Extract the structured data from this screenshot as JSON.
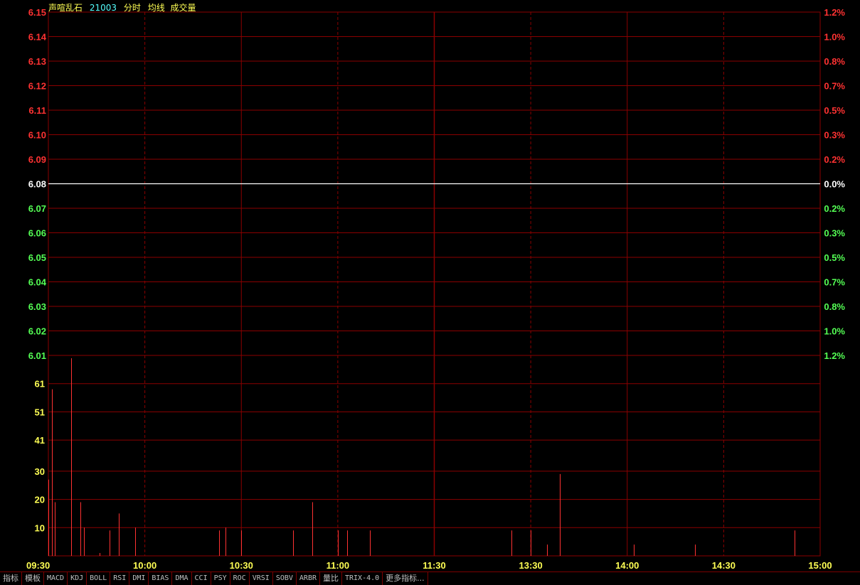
{
  "header": {
    "name": "声喧乱石",
    "code": "21003",
    "ind_time": "分时",
    "ind_avg": "均线",
    "ind_vol": "成交量"
  },
  "colors": {
    "background": "#000000",
    "grid": "#8b0000",
    "up": "#ff3232",
    "down": "#54ff54",
    "neutral": "#ffffff",
    "volume_label": "#ffff54",
    "time_label": "#ffff54",
    "bar": "#ff3232"
  },
  "chart_data": [
    {
      "type": "line",
      "title": "分时",
      "base_price": 6.08,
      "y_ticks": [
        {
          "price": "6.15",
          "pct": "1.2%",
          "dir": "up"
        },
        {
          "price": "6.14",
          "pct": "1.0%",
          "dir": "up"
        },
        {
          "price": "6.13",
          "pct": "0.8%",
          "dir": "up"
        },
        {
          "price": "6.12",
          "pct": "0.7%",
          "dir": "up"
        },
        {
          "price": "6.11",
          "pct": "0.5%",
          "dir": "up"
        },
        {
          "price": "6.10",
          "pct": "0.3%",
          "dir": "up"
        },
        {
          "price": "6.09",
          "pct": "0.2%",
          "dir": "up"
        },
        {
          "price": "6.08",
          "pct": "0.0%",
          "dir": "flat"
        },
        {
          "price": "6.07",
          "pct": "0.2%",
          "dir": "down"
        },
        {
          "price": "6.06",
          "pct": "0.3%",
          "dir": "down"
        },
        {
          "price": "6.05",
          "pct": "0.5%",
          "dir": "down"
        },
        {
          "price": "6.04",
          "pct": "0.7%",
          "dir": "down"
        },
        {
          "price": "6.03",
          "pct": "0.8%",
          "dir": "down"
        },
        {
          "price": "6.02",
          "pct": "1.0%",
          "dir": "down"
        },
        {
          "price": "6.01",
          "pct": "1.2%",
          "dir": "down"
        }
      ],
      "ylim": [
        6.01,
        6.15
      ],
      "series": [
        {
          "values": [
            6.08,
            6.08
          ]
        }
      ],
      "grid": true
    },
    {
      "type": "bar",
      "title": "成交量",
      "y_ticks": [
        "61",
        "51",
        "41",
        "30",
        "20",
        "10"
      ],
      "y_tick_values": [
        61,
        51,
        41,
        30,
        20,
        10
      ],
      "ylim": [
        0,
        71
      ],
      "x_ticks": [
        "09:30",
        "10:00",
        "10:30",
        "11:00",
        "11:30",
        "13:30",
        "14:00",
        "14:30",
        "15:00"
      ],
      "x_tick_minutes": [
        0,
        30,
        60,
        90,
        120,
        150,
        180,
        210,
        240
      ],
      "xlim": [
        0,
        240
      ],
      "bars": [
        {
          "minute": 0,
          "value": 27
        },
        {
          "minute": 1,
          "value": 59
        },
        {
          "minute": 2,
          "value": 19
        },
        {
          "minute": 7,
          "value": 70
        },
        {
          "minute": 10,
          "value": 19
        },
        {
          "minute": 11,
          "value": 10
        },
        {
          "minute": 16,
          "value": 1
        },
        {
          "minute": 19,
          "value": 9
        },
        {
          "minute": 22,
          "value": 15
        },
        {
          "minute": 27,
          "value": 10
        },
        {
          "minute": 53,
          "value": 9
        },
        {
          "minute": 55,
          "value": 10
        },
        {
          "minute": 60,
          "value": 9
        },
        {
          "minute": 76,
          "value": 9
        },
        {
          "minute": 82,
          "value": 19
        },
        {
          "minute": 90,
          "value": 9
        },
        {
          "minute": 93,
          "value": 9
        },
        {
          "minute": 100,
          "value": 9
        },
        {
          "minute": 144,
          "value": 9
        },
        {
          "minute": 150,
          "value": 9
        },
        {
          "minute": 155,
          "value": 4
        },
        {
          "minute": 159,
          "value": 29
        },
        {
          "minute": 182,
          "value": 4
        },
        {
          "minute": 201,
          "value": 4
        },
        {
          "minute": 232,
          "value": 9
        }
      ],
      "grid": true
    }
  ],
  "tabs": [
    {
      "label": "指标",
      "mono": false
    },
    {
      "label": "模板",
      "mono": false
    },
    {
      "label": "MACD",
      "mono": true
    },
    {
      "label": "KDJ",
      "mono": true
    },
    {
      "label": "BOLL",
      "mono": true
    },
    {
      "label": "RSI",
      "mono": true
    },
    {
      "label": "DMI",
      "mono": true
    },
    {
      "label": "BIAS",
      "mono": true
    },
    {
      "label": "DMA",
      "mono": true
    },
    {
      "label": "CCI",
      "mono": true
    },
    {
      "label": "PSY",
      "mono": true
    },
    {
      "label": "ROC",
      "mono": true
    },
    {
      "label": "VRSI",
      "mono": true
    },
    {
      "label": "SOBV",
      "mono": true
    },
    {
      "label": "ARBR",
      "mono": true
    },
    {
      "label": "量比",
      "mono": false
    },
    {
      "label": "TRIX-4.0",
      "mono": true
    },
    {
      "label": "更多指标...",
      "mono": false
    }
  ]
}
